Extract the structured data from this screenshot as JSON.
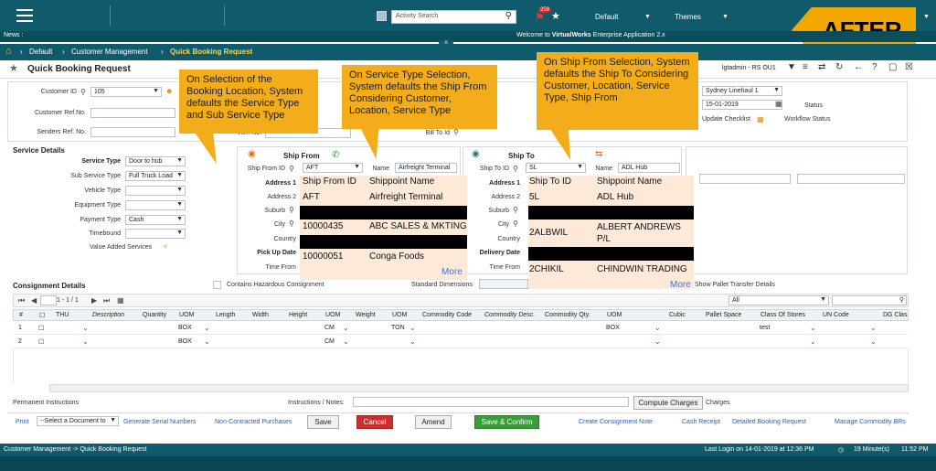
{
  "header": {
    "search_placeholder": "Activity Search",
    "notification_count": "259",
    "menu_default": "Default",
    "menu_themes": "Themes"
  },
  "badge_after": "AFTER",
  "news": {
    "label": "News :",
    "welcome_prefix": "Welcome to ",
    "welcome_brand": "VirtualWorks",
    "welcome_suffix": " Enterprise Application 2.x"
  },
  "breadcrumb": [
    "Default",
    "Customer Management",
    "Quick Booking Request"
  ],
  "page_title": "Quick Booking Request",
  "user_info": "lgtadmin - RS OU1",
  "form": {
    "customer_id_label": "Customer ID",
    "customer_id_value": "105",
    "customer_ref_label": "Customer Ref.No.",
    "senders_ref_label": "Senders Ref. No.",
    "ref_no_label": "Ref. No.",
    "bill_to_label": "Bill To Id",
    "location_value": "Sydney Linehaul 1",
    "date_value": "15-01-2019",
    "status_label": "Status",
    "update_checklist_label": "Update Checklist",
    "workflow_status_label": "Workflow Status"
  },
  "service": {
    "section_title": "Service Details",
    "service_type_label": "Service Type",
    "service_type_value": "Door to hub",
    "sub_service_label": "Sub Service Type",
    "sub_service_value": "Full Truck Load",
    "vehicle_type_label": "Vehicle Type",
    "equipment_type_label": "Equipment Type",
    "payment_type_label": "Payment Type",
    "payment_type_value": "Cash",
    "timebound_label": "Timebound",
    "value_added_label": "Value Added Services"
  },
  "ship_from": {
    "title": "Ship From",
    "id_label": "Ship From ID",
    "id_value": "AFT",
    "name_label": "Name",
    "name_value": "Airfreight Terminal",
    "address1_label": "Address 1",
    "address2_label": "Address 2",
    "suburb_label": "Suburb",
    "city_label": "City",
    "country_label": "Country",
    "pickup_label": "Pick Up Date",
    "time_from_label": "Time From"
  },
  "ship_to": {
    "title": "Ship To",
    "id_label": "Ship To ID",
    "id_value": "SL",
    "name_label": "Name",
    "name_value": "ADL Hub",
    "address1_label": "Address 1",
    "address2_label": "Address 2",
    "suburb_label": "Suburb",
    "city_label": "City",
    "country_label": "Country",
    "delivery_label": "Delivery Date",
    "time_from_label": "Time From"
  },
  "callouts": {
    "booking": "On Selection of the Booking Location, System defaults the Service Type and Sub Service Type",
    "service": "On Service Type Selection, System defaults the Ship From Considering Customer, Location, Service Type",
    "shipfrom": "On  Ship From Selection, System defaults the Ship To Considering Customer, Location, Service Type, Ship From"
  },
  "ship_from_lookup": {
    "headers": [
      "Ship From ID",
      "Shippoint Name"
    ],
    "rows": [
      [
        "AFT",
        "Airfreight Terminal"
      ],
      [
        "10000435",
        "ABC SALES & MKTING"
      ],
      [
        "10000051",
        "Conga Foods"
      ]
    ],
    "more": "More"
  },
  "ship_to_lookup": {
    "headers": [
      "Ship To ID",
      "Shippoint Name"
    ],
    "rows": [
      [
        "5L",
        "ADL Hub"
      ],
      [
        "2ALBWIL",
        "ALBERT ANDREWS P/L"
      ],
      [
        "2CHIKIL",
        "CHINDWIN TRADING"
      ]
    ],
    "more": "More"
  },
  "consignment": {
    "title": "Consignment Details",
    "hazardous_label": "Contains Hazardous Consignment",
    "standard_dims_label": "Standard Dimensions",
    "pallet_transfer_label": "Show Pallet Transfer Details",
    "filter_value": "All",
    "pager_text": "1 - 1 / 1",
    "columns": [
      "#",
      "THU",
      "Description",
      "Quantity",
      "UOM",
      "Length",
      "Width",
      "Height",
      "UOM",
      "Weight",
      "UOM",
      "Commodity Code",
      "Commodity Desc.",
      "Commodity Qty.",
      "UOM",
      "Cubic",
      "Pallet Space",
      "Class Of Stores",
      "UN Code",
      "DG Clas"
    ],
    "rows": [
      {
        "num": "1",
        "uom1": "BOX",
        "uom2": "CM",
        "uom3": "TON",
        "uom4": "BOX",
        "class": "test"
      },
      {
        "num": "2",
        "uom1": "BOX",
        "uom2": "CM",
        "uom3": "",
        "uom4": "",
        "class": ""
      }
    ]
  },
  "bottom": {
    "permanent_instructions": "Permanent Instructions",
    "instructions_notes": "Instructions / Notes:",
    "compute_charges": "Compute Charges",
    "charges": "Charges",
    "print": "Print",
    "select_document": "--Select a Document to",
    "generate_serial": "Generate Serial Numbers",
    "non_contracted": "Non-Contracted Purchases",
    "save": "Save",
    "cancel": "Cancel",
    "amend": "Amend",
    "save_confirm": "Save & Confirm",
    "create_note": "Create Consignment Note",
    "cash_receipt": "Cash Receipt",
    "detailed_booking": "Detailed Booking Request",
    "manage_commodity": "Manage Commodity BRs"
  },
  "footer": {
    "path": "Customer Management -> Quick Booking Request",
    "last_login": "Last Login on 14-01-2019 at 12:36 PM",
    "minutes": "19 Minute(s)",
    "clock": "11:52 PM"
  }
}
